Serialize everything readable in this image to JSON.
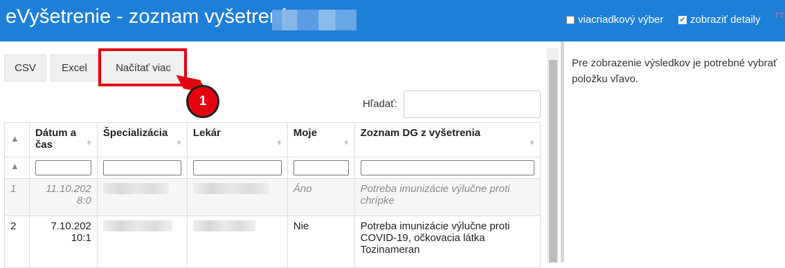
{
  "header": {
    "title": "eVyšetrenie - zoznam vyšetrení",
    "multi_select_label": "viacriadkový výber",
    "show_details_label": "zobraziť detaily",
    "show_details_checked": true,
    "multi_select_checked": false
  },
  "toolbar": {
    "csv": "CSV",
    "excel": "Excel",
    "load_more": "Načítať viac"
  },
  "annotation": {
    "badge": "1"
  },
  "search": {
    "label": "Hľadať:",
    "value": ""
  },
  "table": {
    "headers": [
      "Dátum a čas",
      "Špecializácia",
      "Lekár",
      "Moje",
      "Zoznam DG z vyšetrenia"
    ],
    "rows": [
      {
        "num": "1",
        "date": "11.10.202",
        "time": "8:0",
        "moje": "Áno",
        "dg": "Potreba imunizácie výlučne proti chrípke"
      },
      {
        "num": "2",
        "date": "7.10.202",
        "time": "10:1",
        "moje": "Nie",
        "dg": "Potreba imunizácie výlučne proti COVID-19, očkovacia látka Tozinameran"
      }
    ]
  },
  "right_panel": {
    "message": "Pre zobrazenie výsledkov je potrebné vybrať položku vľavo."
  },
  "colors": {
    "header_bg": "#1e7fd8",
    "highlight": "#e3000f"
  }
}
